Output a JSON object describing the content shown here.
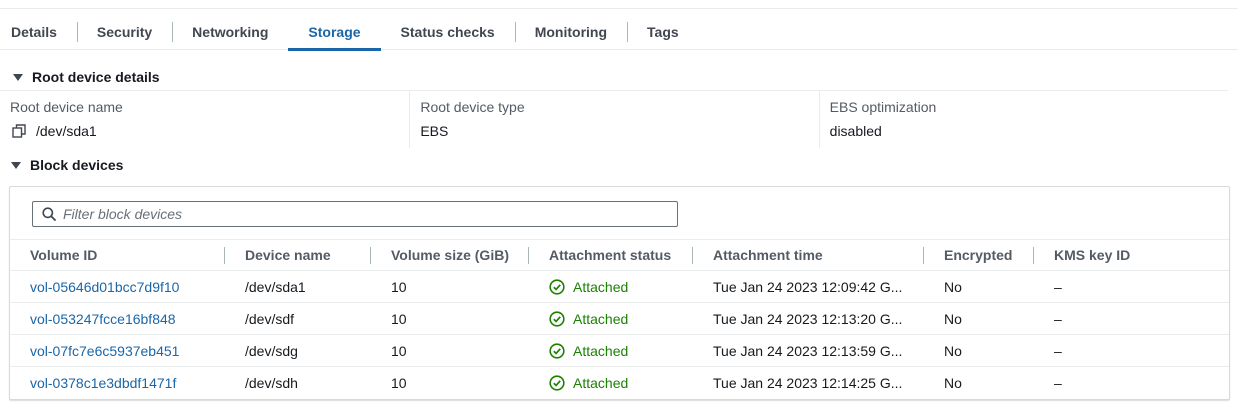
{
  "tabs": [
    {
      "label": "Details",
      "active": false
    },
    {
      "label": "Security",
      "active": false
    },
    {
      "label": "Networking",
      "active": false
    },
    {
      "label": "Storage",
      "active": true
    },
    {
      "label": "Status checks",
      "active": false
    },
    {
      "label": "Monitoring",
      "active": false
    },
    {
      "label": "Tags",
      "active": false
    }
  ],
  "root_device": {
    "header": "Root device details",
    "name_label": "Root device name",
    "name_value": "/dev/sda1",
    "type_label": "Root device type",
    "type_value": "EBS",
    "ebs_label": "EBS optimization",
    "ebs_value": "disabled"
  },
  "block_devices": {
    "header": "Block devices",
    "filter_placeholder": "Filter block devices",
    "columns": [
      "Volume ID",
      "Device name",
      "Volume size (GiB)",
      "Attachment status",
      "Attachment time",
      "Encrypted",
      "KMS key ID"
    ],
    "rows": [
      {
        "volume_id": "vol-05646d01bcc7d9f10",
        "device": "/dev/sda1",
        "size": "10",
        "status": "Attached",
        "time": "Tue Jan 24 2023 12:09:42 G...",
        "encrypted": "No",
        "kms": "–"
      },
      {
        "volume_id": "vol-053247fcce16bf848",
        "device": "/dev/sdf",
        "size": "10",
        "status": "Attached",
        "time": "Tue Jan 24 2023 12:13:20 G...",
        "encrypted": "No",
        "kms": "–"
      },
      {
        "volume_id": "vol-07fc7e6c5937eb451",
        "device": "/dev/sdg",
        "size": "10",
        "status": "Attached",
        "time": "Tue Jan 24 2023 12:13:59 G...",
        "encrypted": "No",
        "kms": "–"
      },
      {
        "volume_id": "vol-0378c1e3dbdf1471f",
        "device": "/dev/sdh",
        "size": "10",
        "status": "Attached",
        "time": "Tue Jan 24 2023 12:14:25 G...",
        "encrypted": "No",
        "kms": "–"
      }
    ]
  },
  "colors": {
    "accent": "#1b66a8",
    "success": "#1d8102"
  },
  "icons": {
    "copy": "copy-icon",
    "search": "search-icon",
    "status": "check-circle-icon",
    "expand": "caret-down-icon"
  }
}
